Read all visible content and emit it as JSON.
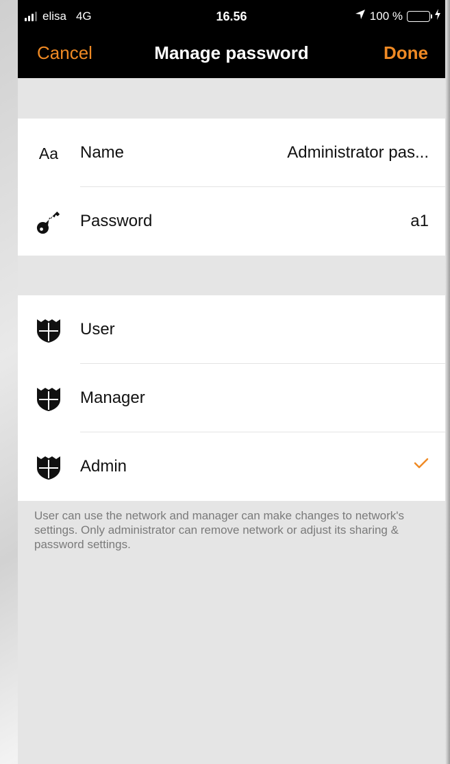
{
  "status_bar": {
    "carrier": "elisa",
    "network": "4G",
    "time": "16.56",
    "battery": "100 %",
    "battery_color": "#4cd964"
  },
  "nav": {
    "cancel_label": "Cancel",
    "title": "Manage password",
    "done_label": "Done",
    "accent_color": "#f08a24"
  },
  "details": {
    "name": {
      "icon_text": "Aa",
      "label": "Name",
      "value": "Administrator pas..."
    },
    "password": {
      "icon": "key-icon",
      "label": "Password",
      "value": "a1"
    }
  },
  "roles": {
    "items": [
      {
        "icon": "shield-icon",
        "label": "User",
        "selected": false
      },
      {
        "icon": "shield-icon",
        "label": "Manager",
        "selected": false
      },
      {
        "icon": "shield-icon",
        "label": "Admin",
        "selected": true
      }
    ]
  },
  "footer_text": "User can use the network and manager can make changes to network's settings. Only administrator can remove network or adjust its sharing & password settings."
}
